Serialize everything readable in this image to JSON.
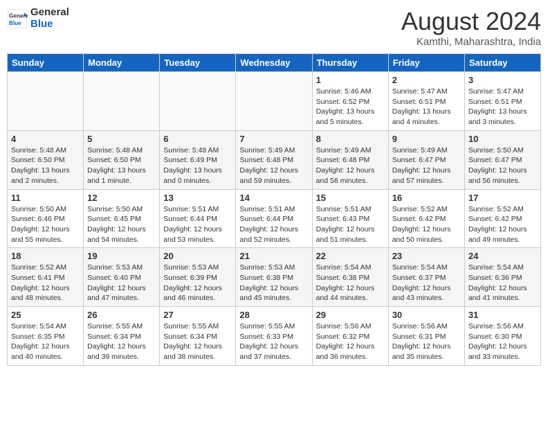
{
  "header": {
    "logo_line1": "General",
    "logo_line2": "Blue",
    "month_title": "August 2024",
    "location": "Kamthi, Maharashtra, India"
  },
  "weekdays": [
    "Sunday",
    "Monday",
    "Tuesday",
    "Wednesday",
    "Thursday",
    "Friday",
    "Saturday"
  ],
  "weeks": [
    [
      {
        "day": "",
        "info": ""
      },
      {
        "day": "",
        "info": ""
      },
      {
        "day": "",
        "info": ""
      },
      {
        "day": "",
        "info": ""
      },
      {
        "day": "1",
        "info": "Sunrise: 5:46 AM\nSunset: 6:52 PM\nDaylight: 13 hours\nand 5 minutes."
      },
      {
        "day": "2",
        "info": "Sunrise: 5:47 AM\nSunset: 6:51 PM\nDaylight: 13 hours\nand 4 minutes."
      },
      {
        "day": "3",
        "info": "Sunrise: 5:47 AM\nSunset: 6:51 PM\nDaylight: 13 hours\nand 3 minutes."
      }
    ],
    [
      {
        "day": "4",
        "info": "Sunrise: 5:48 AM\nSunset: 6:50 PM\nDaylight: 13 hours\nand 2 minutes."
      },
      {
        "day": "5",
        "info": "Sunrise: 5:48 AM\nSunset: 6:50 PM\nDaylight: 13 hours\nand 1 minute."
      },
      {
        "day": "6",
        "info": "Sunrise: 5:48 AM\nSunset: 6:49 PM\nDaylight: 13 hours\nand 0 minutes."
      },
      {
        "day": "7",
        "info": "Sunrise: 5:49 AM\nSunset: 6:48 PM\nDaylight: 12 hours\nand 59 minutes."
      },
      {
        "day": "8",
        "info": "Sunrise: 5:49 AM\nSunset: 6:48 PM\nDaylight: 12 hours\nand 58 minutes."
      },
      {
        "day": "9",
        "info": "Sunrise: 5:49 AM\nSunset: 6:47 PM\nDaylight: 12 hours\nand 57 minutes."
      },
      {
        "day": "10",
        "info": "Sunrise: 5:50 AM\nSunset: 6:47 PM\nDaylight: 12 hours\nand 56 minutes."
      }
    ],
    [
      {
        "day": "11",
        "info": "Sunrise: 5:50 AM\nSunset: 6:46 PM\nDaylight: 12 hours\nand 55 minutes."
      },
      {
        "day": "12",
        "info": "Sunrise: 5:50 AM\nSunset: 6:45 PM\nDaylight: 12 hours\nand 54 minutes."
      },
      {
        "day": "13",
        "info": "Sunrise: 5:51 AM\nSunset: 6:44 PM\nDaylight: 12 hours\nand 53 minutes."
      },
      {
        "day": "14",
        "info": "Sunrise: 5:51 AM\nSunset: 6:44 PM\nDaylight: 12 hours\nand 52 minutes."
      },
      {
        "day": "15",
        "info": "Sunrise: 5:51 AM\nSunset: 6:43 PM\nDaylight: 12 hours\nand 51 minutes."
      },
      {
        "day": "16",
        "info": "Sunrise: 5:52 AM\nSunset: 6:42 PM\nDaylight: 12 hours\nand 50 minutes."
      },
      {
        "day": "17",
        "info": "Sunrise: 5:52 AM\nSunset: 6:42 PM\nDaylight: 12 hours\nand 49 minutes."
      }
    ],
    [
      {
        "day": "18",
        "info": "Sunrise: 5:52 AM\nSunset: 6:41 PM\nDaylight: 12 hours\nand 48 minutes."
      },
      {
        "day": "19",
        "info": "Sunrise: 5:53 AM\nSunset: 6:40 PM\nDaylight: 12 hours\nand 47 minutes."
      },
      {
        "day": "20",
        "info": "Sunrise: 5:53 AM\nSunset: 6:39 PM\nDaylight: 12 hours\nand 46 minutes."
      },
      {
        "day": "21",
        "info": "Sunrise: 5:53 AM\nSunset: 6:38 PM\nDaylight: 12 hours\nand 45 minutes."
      },
      {
        "day": "22",
        "info": "Sunrise: 5:54 AM\nSunset: 6:38 PM\nDaylight: 12 hours\nand 44 minutes."
      },
      {
        "day": "23",
        "info": "Sunrise: 5:54 AM\nSunset: 6:37 PM\nDaylight: 12 hours\nand 43 minutes."
      },
      {
        "day": "24",
        "info": "Sunrise: 5:54 AM\nSunset: 6:36 PM\nDaylight: 12 hours\nand 41 minutes."
      }
    ],
    [
      {
        "day": "25",
        "info": "Sunrise: 5:54 AM\nSunset: 6:35 PM\nDaylight: 12 hours\nand 40 minutes."
      },
      {
        "day": "26",
        "info": "Sunrise: 5:55 AM\nSunset: 6:34 PM\nDaylight: 12 hours\nand 39 minutes."
      },
      {
        "day": "27",
        "info": "Sunrise: 5:55 AM\nSunset: 6:34 PM\nDaylight: 12 hours\nand 38 minutes."
      },
      {
        "day": "28",
        "info": "Sunrise: 5:55 AM\nSunset: 6:33 PM\nDaylight: 12 hours\nand 37 minutes."
      },
      {
        "day": "29",
        "info": "Sunrise: 5:56 AM\nSunset: 6:32 PM\nDaylight: 12 hours\nand 36 minutes."
      },
      {
        "day": "30",
        "info": "Sunrise: 5:56 AM\nSunset: 6:31 PM\nDaylight: 12 hours\nand 35 minutes."
      },
      {
        "day": "31",
        "info": "Sunrise: 5:56 AM\nSunset: 6:30 PM\nDaylight: 12 hours\nand 33 minutes."
      }
    ]
  ]
}
